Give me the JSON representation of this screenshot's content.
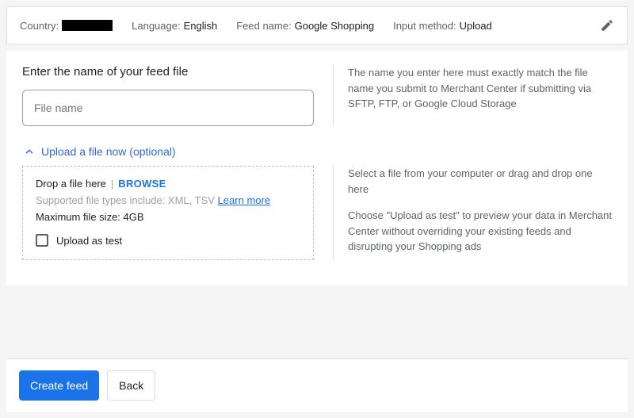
{
  "summary": {
    "country_label": "Country:",
    "language_label": "Language:",
    "language_value": "English",
    "feedname_label": "Feed name:",
    "feedname_value": "Google Shopping",
    "inputmethod_label": "Input method:",
    "inputmethod_value": "Upload"
  },
  "filename": {
    "heading": "Enter the name of your feed file",
    "placeholder": "File name",
    "help": "The name you enter here must exactly match the file name you submit to Merchant Center if submitting via SFTP, FTP, or Google Cloud Storage"
  },
  "upload": {
    "expander_label": "Upload a file now (optional)",
    "drop_text": "Drop a file here",
    "browse_label": "BROWSE",
    "supported_text": "Supported file types include: XML, TSV",
    "learn_more": "Learn more",
    "max_size": "Maximum file size: 4GB",
    "checkbox_label": "Upload as test",
    "help1": "Select a file from your computer or drag and drop one here",
    "help2": "Choose \"Upload as test\" to preview your data in Merchant Center without overriding your existing feeds and disrupting your Shopping ads"
  },
  "footer": {
    "create": "Create feed",
    "back": "Back"
  }
}
